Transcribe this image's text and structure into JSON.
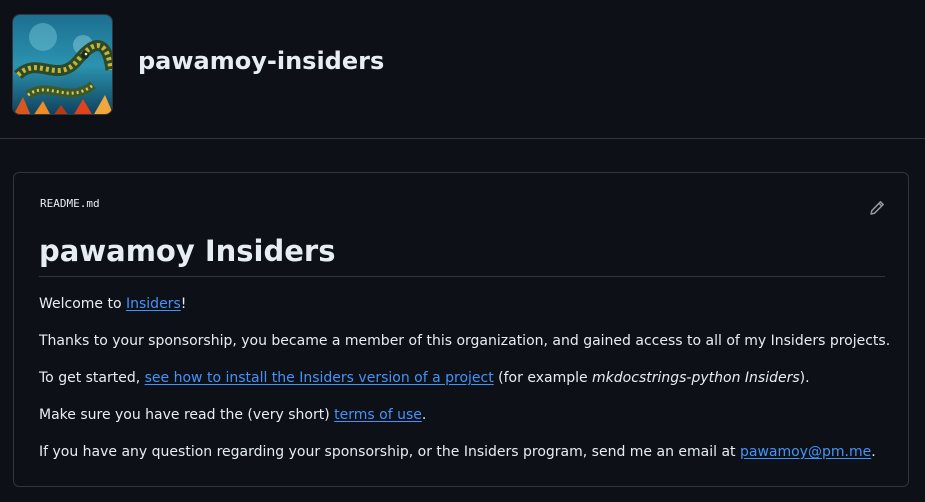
{
  "org": {
    "name": "pawamoy-insiders"
  },
  "readme": {
    "filename": "README.md",
    "edit_icon": "pencil-icon",
    "title": "pawamoy Insiders",
    "p1": {
      "before": "Welcome to ",
      "link": "Insiders",
      "after": "!"
    },
    "p2": "Thanks to your sponsorship, you became a member of this organization, and gained access to all of my Insiders projects.",
    "p3": {
      "before": "To get started, ",
      "link": "see how to install the Insiders version of a project",
      "middle": " (for example ",
      "emph": "mkdocstrings-python Insiders",
      "after": ")."
    },
    "p4": {
      "before": "Make sure you have read the (very short) ",
      "link": "terms of use",
      "after": "."
    },
    "p5": {
      "before": "If you have any question regarding your sponsorship, or the Insiders program, send me an email at ",
      "link": "pawamoy@pm.me",
      "after": "."
    }
  },
  "colors": {
    "background": "#0d1117",
    "text": "#e6edf3",
    "link": "#4493f8",
    "border": "#30363d"
  }
}
